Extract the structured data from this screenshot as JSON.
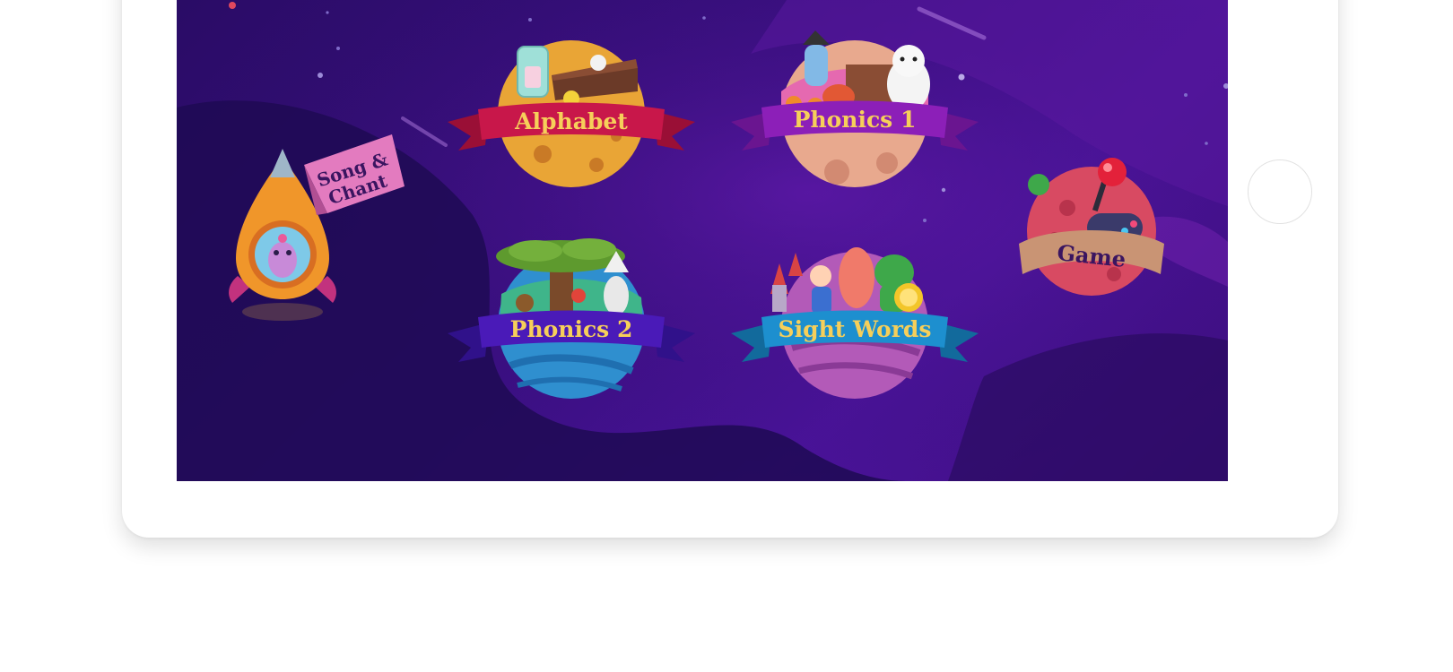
{
  "menu": {
    "song_chant": {
      "line1": "Song &",
      "line2": "Chant"
    },
    "alphabet": {
      "label": "Alphabet"
    },
    "phonics1": {
      "label": "Phonics 1"
    },
    "phonics2": {
      "label": "Phonics 2"
    },
    "sight_words": {
      "label": "Sight Words"
    },
    "game": {
      "label": "Game"
    }
  },
  "colors": {
    "space_dark": "#1e0a52",
    "space_purple": "#4a139a",
    "ribbon_red": "#c8174a",
    "ribbon_purple": "#8c1fb8",
    "ribbon_indigo": "#4a1ab8",
    "ribbon_blue": "#1d8fcf",
    "label_yellow": "#f6cf5a",
    "song_flag_pink": "#e37bbf",
    "game_band": "#c99474"
  }
}
